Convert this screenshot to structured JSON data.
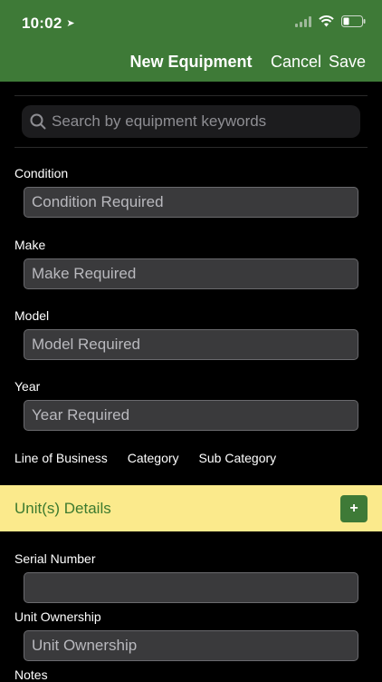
{
  "status": {
    "time": "10:02"
  },
  "nav": {
    "title": "New Equipment",
    "cancel": "Cancel",
    "save": "Save"
  },
  "search": {
    "placeholder": "Search by equipment keywords"
  },
  "form": {
    "condition_label": "Condition",
    "condition_placeholder": "Condition Required",
    "make_label": "Make",
    "make_placeholder": "Make Required",
    "model_label": "Model",
    "model_placeholder": "Model Required",
    "year_label": "Year",
    "year_placeholder": "Year Required"
  },
  "tabs": [
    "Line of Business",
    "Category",
    "Sub Category"
  ],
  "units": {
    "title": "Unit(s) Details",
    "add_label": "+",
    "serial_label": "Serial Number",
    "serial_value": "",
    "ownership_label": "Unit Ownership",
    "ownership_placeholder": "Unit Ownership",
    "notes_label": "Notes"
  },
  "colors": {
    "accent": "#3e7a37",
    "band": "#fbea8c",
    "band_text": "#3d7a2f"
  }
}
